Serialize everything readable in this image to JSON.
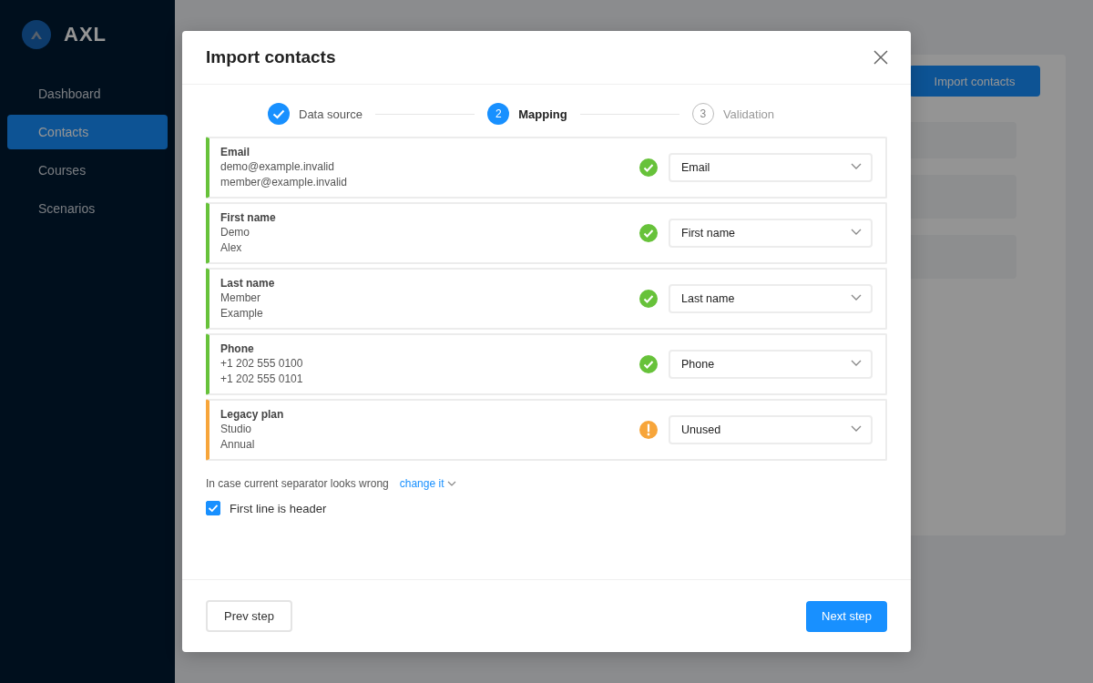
{
  "sidebar": {
    "logo": "AXL",
    "items": [
      {
        "label": "Dashboard",
        "selected": false
      },
      {
        "label": "Contacts",
        "selected": true
      },
      {
        "label": "Courses",
        "selected": false
      },
      {
        "label": "Scenarios",
        "selected": false
      }
    ]
  },
  "page": {
    "action": "Import contacts"
  },
  "dialog": {
    "title": "Import contacts",
    "steps": [
      {
        "label": "Data source",
        "done": true,
        "current": false
      },
      {
        "number": "2",
        "label": "Mapping",
        "done": false,
        "current": true
      },
      {
        "number": "3",
        "label": "Validation",
        "done": false,
        "current": false
      }
    ],
    "mappings": [
      {
        "header": "Email",
        "values": [
          "demo@example.invalid",
          "member@example.invalid"
        ],
        "warning": false,
        "field": "Email"
      },
      {
        "header": "First name",
        "values": [
          "Demo",
          "Alex"
        ],
        "warning": false,
        "field": "First name"
      },
      {
        "header": "Last name",
        "values": [
          "Member",
          "Example"
        ],
        "warning": false,
        "field": "Last name"
      },
      {
        "header": "Phone",
        "values": [
          "+1 202 555 0100",
          "+1 202 555 0101"
        ],
        "warning": false,
        "field": "Phone"
      },
      {
        "header": "Legacy plan",
        "values": [
          "Studio",
          "Annual"
        ],
        "warning": true,
        "field": "Unused"
      }
    ],
    "separator_hint": "In case current separator looks wrong",
    "separator_link": "change it",
    "header_checkbox": {
      "label": "First line is header",
      "checked": true
    },
    "prev_button": "Prev step",
    "next_button": "Next step"
  }
}
